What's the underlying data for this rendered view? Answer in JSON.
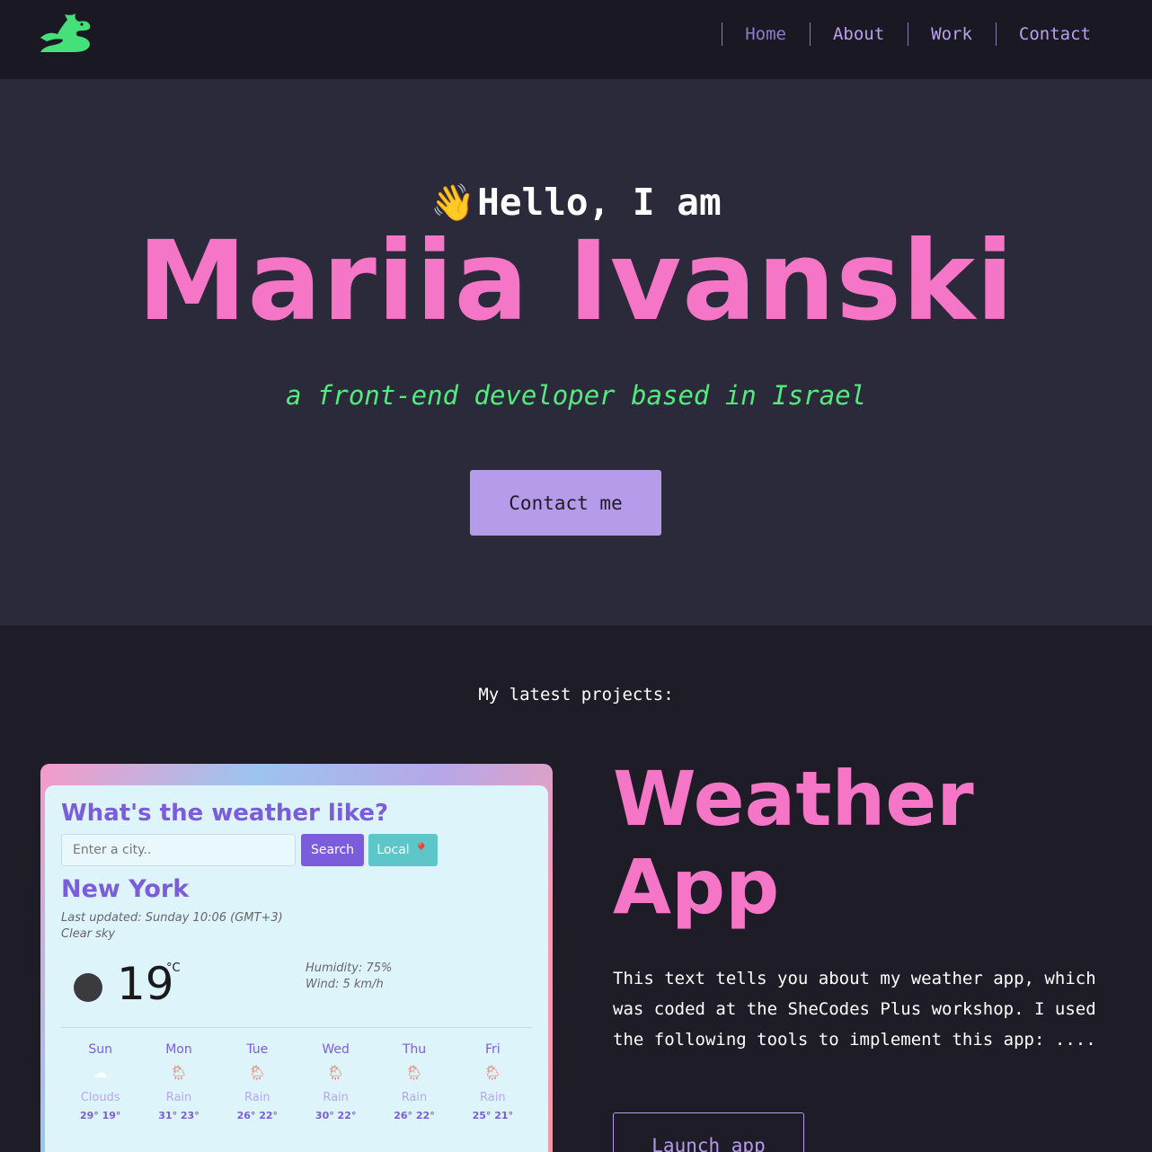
{
  "nav": {
    "logo": "dragon-logo",
    "items": [
      {
        "label": "Home",
        "active": true
      },
      {
        "label": "About"
      },
      {
        "label": "Work"
      },
      {
        "label": "Contact"
      }
    ]
  },
  "hero": {
    "wave": "👋",
    "greeting": "Hello, I am",
    "name": "Mariia Ivanski",
    "tagline": "a front-end developer based in Israel",
    "contact_button": "Contact me"
  },
  "projects": {
    "heading": "My latest projects:",
    "items": [
      {
        "title_line1": "Weather",
        "title_line2": "App",
        "description": "This text tells you about my weather app, which was coded at the SheCodes Plus workshop. I used the following tools to implement this app: ....",
        "button": "Launch app",
        "screenshot": {
          "title": "What's the weather like?",
          "input_placeholder": "Enter a city..",
          "search_label": "Search",
          "local_label": "Local 📍",
          "city": "New York",
          "updated": "Last updated: Sunday 10:06 (GMT+3)",
          "description": "Clear sky",
          "temperature": "19",
          "unit": "°C",
          "humidity": "Humidity: 75%",
          "wind": "Wind: 5 km/h",
          "forecast": [
            {
              "day": "Sun",
              "cond": "Clouds",
              "temps": "29° 19°",
              "icon": "☁"
            },
            {
              "day": "Mon",
              "cond": "Rain",
              "temps": "31° 23°",
              "icon": "🌦"
            },
            {
              "day": "Tue",
              "cond": "Rain",
              "temps": "26° 22°",
              "icon": "🌦"
            },
            {
              "day": "Wed",
              "cond": "Rain",
              "temps": "30° 22°",
              "icon": "🌦"
            },
            {
              "day": "Thu",
              "cond": "Rain",
              "temps": "26° 22°",
              "icon": "🌦"
            },
            {
              "day": "Fri",
              "cond": "Rain",
              "temps": "25° 21°",
              "icon": "🌦"
            }
          ]
        }
      }
    ]
  },
  "colors": {
    "accent_pink": "#f576c7",
    "accent_green": "#52eb7c",
    "accent_purple": "#b59bea"
  }
}
